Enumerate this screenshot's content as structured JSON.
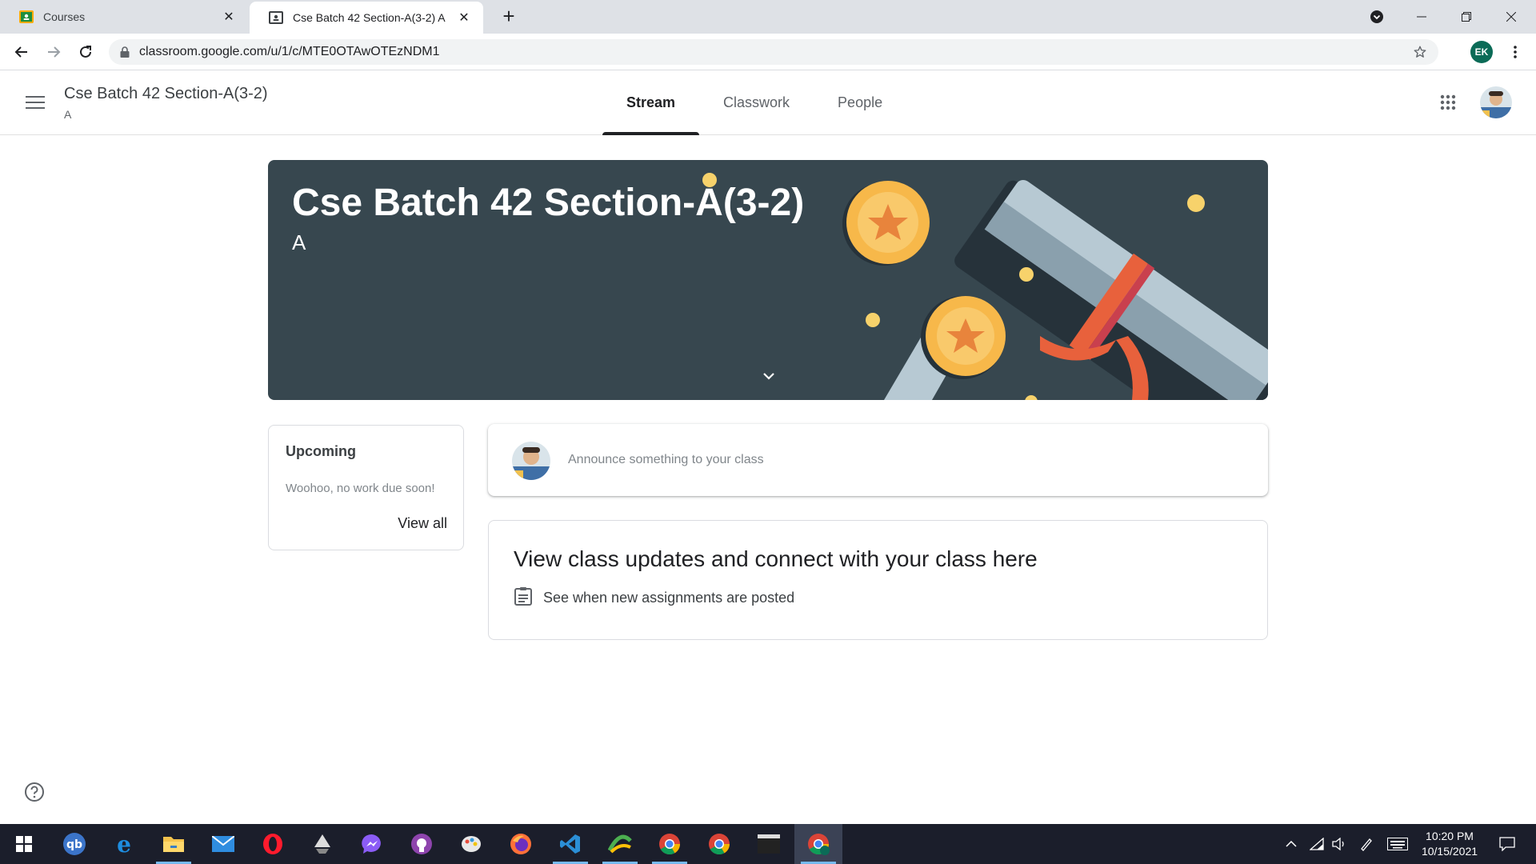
{
  "browser": {
    "tabs": [
      {
        "title": "Courses",
        "icon": "classroom-favicon",
        "active": false
      },
      {
        "title": "Cse Batch 42 Section-A(3-2) A",
        "icon": "classroom-favicon",
        "active": true
      }
    ],
    "url": "classroom.google.com/u/1/c/MTE0OTAwOTEzNDM1",
    "profile_initials": "EK"
  },
  "header": {
    "course_title": "Cse Batch 42 Section-A(3-2)",
    "course_section": "A",
    "tabs": [
      {
        "label": "Stream",
        "active": true
      },
      {
        "label": "Classwork",
        "active": false
      },
      {
        "label": "People",
        "active": false
      }
    ]
  },
  "banner": {
    "title": "Cse Batch 42 Section-A(3-2)",
    "section": "A",
    "colors": {
      "background": "#37474f",
      "coin": "#f7b84a",
      "ribbon": "#e8613c"
    }
  },
  "upcoming": {
    "title": "Upcoming",
    "empty_text": "Woohoo, no work due soon!",
    "view_all": "View all"
  },
  "announce": {
    "placeholder": "Announce something to your class"
  },
  "info_card": {
    "title": "View class updates and connect with your class here",
    "line": "See when new assignments are posted"
  },
  "taskbar": {
    "apps": [
      "start-icon",
      "qbittorrent-icon",
      "edge-icon",
      "file-explorer-icon",
      "mail-icon",
      "opera-icon",
      "inkscape-icon",
      "messenger-icon",
      "github-desktop-icon",
      "paint-icon",
      "firefox-icon",
      "vscode-icon",
      "app-icon",
      "chrome-icon",
      "chrome-icon",
      "terminal-icon",
      "chrome-profile-icon"
    ],
    "time": "10:20 PM",
    "date": "10/15/2021"
  }
}
